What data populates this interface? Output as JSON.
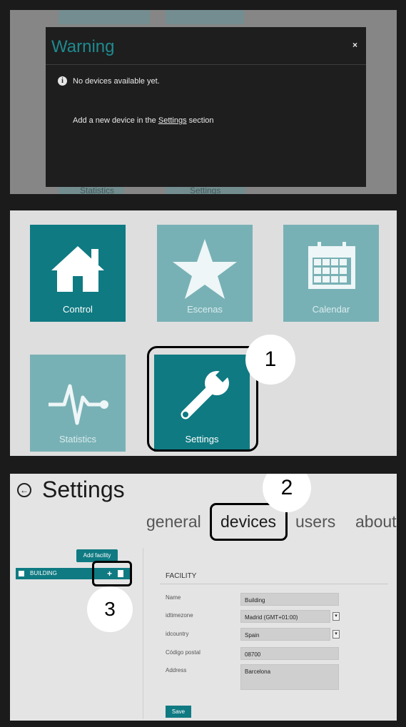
{
  "panel1": {
    "background_tiles": [
      {
        "label": "Statistics"
      },
      {
        "label": "Settings"
      }
    ],
    "modal": {
      "title": "Warning",
      "close": "×",
      "info_icon": "i",
      "message": "No devices available yet.",
      "line2_prefix": "Add a new device in the ",
      "line2_link": "Settings",
      "line2_suffix": " section"
    }
  },
  "panel2": {
    "tiles": [
      {
        "label": "Control",
        "icon": "house-icon"
      },
      {
        "label": "Escenas",
        "icon": "star-icon"
      },
      {
        "label": "Calendar",
        "icon": "calendar-icon"
      },
      {
        "label": "Statistics",
        "icon": "pulse-icon"
      },
      {
        "label": "Settings",
        "icon": "wrench-icon"
      }
    ],
    "step_marker": "1"
  },
  "panel3": {
    "back_icon": "arrow-left-icon",
    "title": "Settings",
    "tabs": [
      "general",
      "devices",
      "users",
      "about"
    ],
    "active_tab": "devices",
    "step_marker_tabs": "2",
    "add_facility_label": "Add facility",
    "building": {
      "label": "BUILDING",
      "add": "+"
    },
    "step_marker_buttons": "3",
    "facility": {
      "title": "FACILITY",
      "fields": [
        {
          "label": "Name",
          "value": "Building"
        },
        {
          "label": "idtimezone",
          "value": "Madrid (GMT+01:00)"
        },
        {
          "label": "idcountry",
          "value": "Spain"
        },
        {
          "label": "Código postal",
          "value": "08700"
        },
        {
          "label": "Address",
          "value": "Barcelona"
        }
      ],
      "select_arrow": "▾",
      "save_label": "Save"
    }
  },
  "colors": {
    "teal_dark": "#0f7a82",
    "teal_light": "#78b1b5",
    "modal_title": "#1f8a8f"
  }
}
